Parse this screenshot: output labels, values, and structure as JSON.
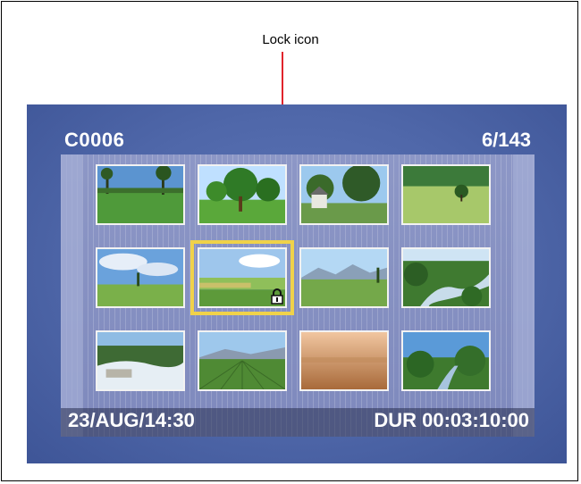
{
  "annotation": {
    "label": "Lock icon"
  },
  "header": {
    "clip_name": "C0006",
    "clip_count": "6/143"
  },
  "thumbnails": [
    {
      "scene": "park-with-palm-trees"
    },
    {
      "scene": "green-tree-meadow"
    },
    {
      "scene": "house-in-trees"
    },
    {
      "scene": "grass-field-single-tree"
    },
    {
      "scene": "sky-over-green-hill"
    },
    {
      "scene": "farm-landscape-locked",
      "selected": true,
      "locked": true
    },
    {
      "scene": "mountain-pasture"
    },
    {
      "scene": "forest-stream"
    },
    {
      "scene": "waterfall"
    },
    {
      "scene": "plowed-field-mountains"
    },
    {
      "scene": "misty-sunset-plains"
    },
    {
      "scene": "river-valley-trees"
    }
  ],
  "status": {
    "date_time": "23/AUG/14:30",
    "duration": "DUR 00:03:10:00"
  },
  "colors": {
    "screen_bg": "#4f67a9",
    "selection": "#f0d24a",
    "callout": "#e0242c"
  }
}
